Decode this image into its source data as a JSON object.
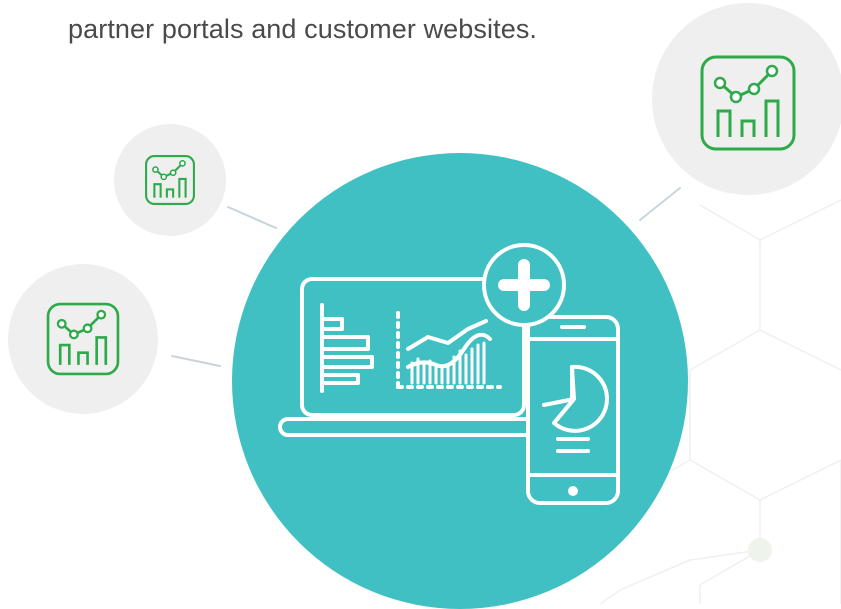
{
  "caption": "partner portals and customer websites.",
  "colors": {
    "hub": "#40c0c2",
    "satellite": "#efefef",
    "icon_green": "#2eaa4a",
    "connector": "#c9d4da",
    "pattern": "#eef1f0",
    "text": "#4a4a4a"
  },
  "icons": {
    "satellite": "analytics-chart-icon",
    "laptop": "laptop-dashboard-icon",
    "phone": "smartphone-pie-chart-icon",
    "plus": "plus-badge-icon"
  }
}
